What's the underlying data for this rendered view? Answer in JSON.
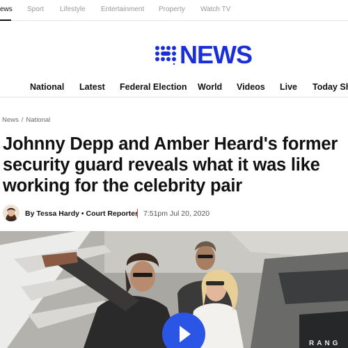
{
  "top_nav": {
    "items": [
      "ews",
      "Sport",
      "Lifestyle",
      "Entertainment",
      "Property",
      "Watch TV"
    ]
  },
  "logo": {
    "text": "NEWS",
    "brand_color": "#1a2fd8"
  },
  "main_nav": {
    "items": [
      "National",
      "Latest",
      "Federal Election",
      "World",
      "Videos",
      "Live",
      "Today Sh"
    ]
  },
  "breadcrumb": {
    "items": [
      "News",
      "National"
    ],
    "separator": "/"
  },
  "article": {
    "headline_lines": [
      "Johnny Depp and Amber Heard's former",
      "security guard reveals what it was like",
      "working for the celebrity pair"
    ],
    "author": "By Tessa Hardy • Court Reporter",
    "divider": "|",
    "date": "7:51pm Jul 20, 2020"
  },
  "hero": {
    "play_button_icon": "play-icon",
    "accent_color": "#2a55e5",
    "car_plate_text": "RANG"
  }
}
